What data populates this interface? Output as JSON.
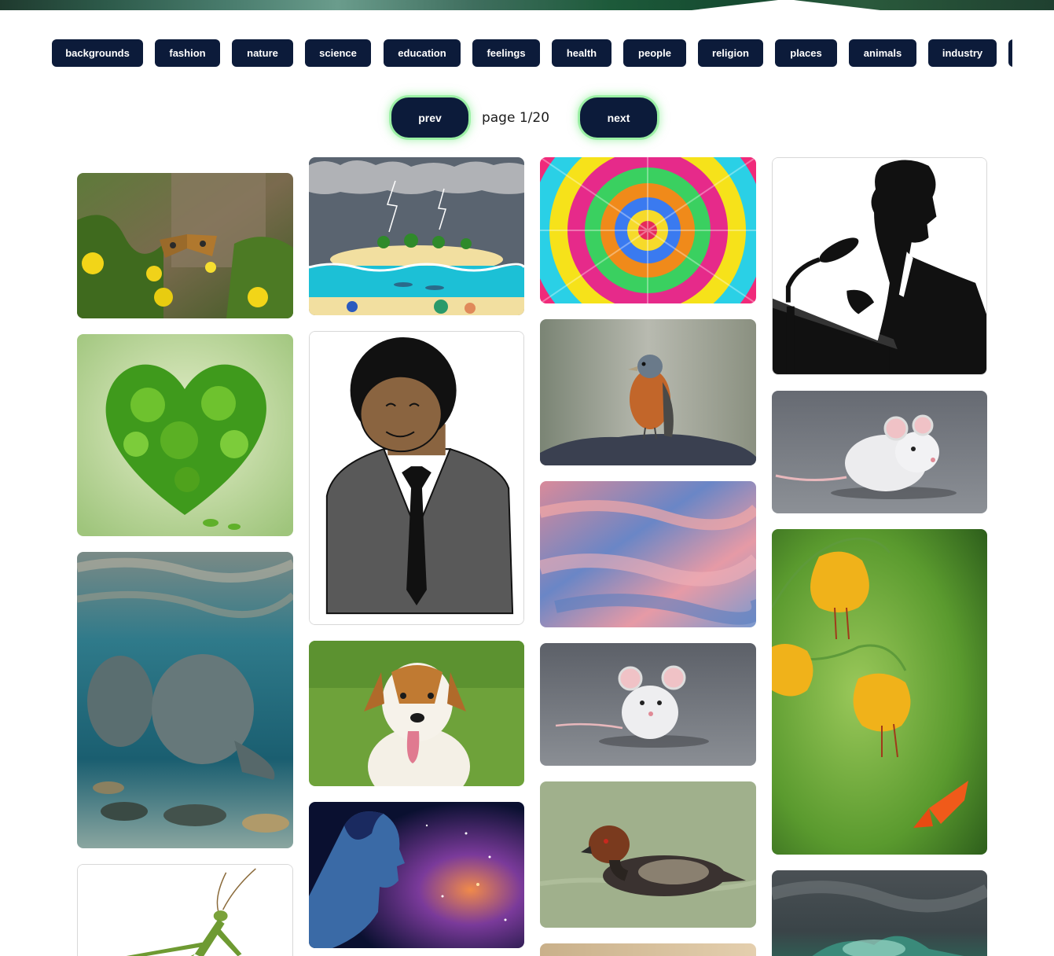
{
  "categories": [
    "backgrounds",
    "fashion",
    "nature",
    "science",
    "education",
    "feelings",
    "health",
    "people",
    "religion",
    "places",
    "animals",
    "industry"
  ],
  "pagination": {
    "prev_label": "prev",
    "next_label": "next",
    "page_text": "page 1/20"
  },
  "colors": {
    "button_bg": "#0c1b3a",
    "button_glow": "#5fe66e",
    "page_bg": "#ffffff"
  },
  "gallery": {
    "images": [
      {
        "name": "butterfly-on-yellow-flowers-image"
      },
      {
        "name": "green-leaf-heart-image"
      },
      {
        "name": "manatees-underwater-image"
      },
      {
        "name": "praying-mantis-image"
      },
      {
        "name": "island-storm-illustration-image"
      },
      {
        "name": "man-in-suit-cartoon-image"
      },
      {
        "name": "smiling-dog-image"
      },
      {
        "name": "cosmic-woman-profile-image"
      },
      {
        "name": "rainbow-kaleidoscope-image"
      },
      {
        "name": "chaffinch-bird-image"
      },
      {
        "name": "pink-sunset-sky-image"
      },
      {
        "name": "white-mouse-image"
      },
      {
        "name": "duck-swimming-image"
      },
      {
        "name": "beige-partial-image"
      },
      {
        "name": "speaker-at-podium-silhouette-image"
      },
      {
        "name": "white-rat-image"
      },
      {
        "name": "yellow-lilies-with-butterfly-image"
      },
      {
        "name": "stormy-sea-image"
      }
    ]
  }
}
